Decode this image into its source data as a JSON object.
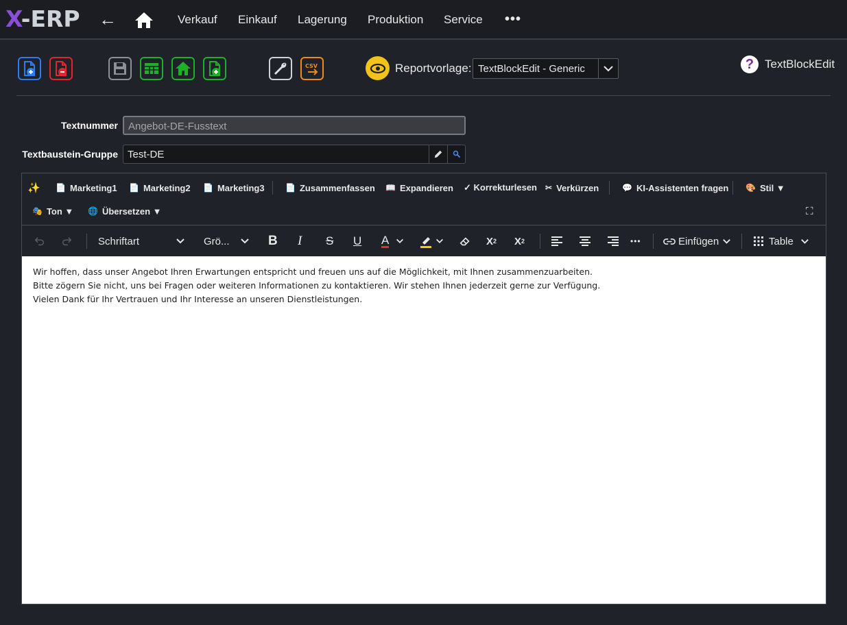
{
  "app": {
    "logo_x": "X",
    "logo_rest": "-ERP"
  },
  "nav": {
    "back_symbol": "←",
    "items": [
      {
        "label": "Verkauf"
      },
      {
        "label": "Einkauf"
      },
      {
        "label": "Lagerung"
      },
      {
        "label": "Produktion"
      },
      {
        "label": "Service"
      }
    ],
    "more_symbol": "•••"
  },
  "toolbar": {
    "csv_text": "CSV",
    "report_label": "Reportvorlage:",
    "report_selected": "TextBlockEdit - Generic",
    "help_symbol": "?",
    "page_name": "TextBlockEdit"
  },
  "form": {
    "textnummer_label": "Textnummer",
    "textnummer_value": "Angebot-DE-Fusstext",
    "gruppe_label": "Textbaustein-Gruppe",
    "gruppe_value": "Test-DE"
  },
  "ai_toolbar": {
    "sparkle": "✨",
    "marketing1": "Marketing1",
    "marketing2": "Marketing2",
    "marketing3": "Marketing3",
    "zusammenfassen": "Zusammenfassen",
    "expandieren": "Expandieren",
    "korrekturlesen": "✓ Korrekturlesen",
    "verkuerzen": "Verkürzen",
    "ki_fragen": "KI-Assistenten fragen",
    "stil": "Stil ▼",
    "ton": "Ton ▼",
    "uebersetzen": "Übersetzen ▼",
    "fullscreen": "⛶"
  },
  "format_toolbar": {
    "font_family": "Schriftart",
    "font_size": "Grö...",
    "bold": "B",
    "italic": "I",
    "strike": "S",
    "underline": "U",
    "font_color": "A",
    "subscript_base": "X",
    "subscript_mark": "2",
    "superscript_base": "X",
    "superscript_mark": "2",
    "more": "•••",
    "insert": "Einfügen",
    "table": "Table",
    "font_color_accent": "#e03030",
    "highlight_accent": "#f5d000"
  },
  "content": {
    "lines": [
      "Wir hoffen, dass unser Angebot Ihren Erwartungen entspricht und freuen uns auf die Möglichkeit, mit Ihnen zusammenzuarbeiten.",
      "Bitte zögern Sie nicht, uns bei Fragen oder weiteren Informationen zu kontaktieren. Wir stehen Ihnen jederzeit gerne zur Verfügung.",
      "Vielen Dank für Ihr Vertrauen und Ihr Interesse an unseren Dienstleistungen."
    ]
  },
  "colors": {
    "bg": "#1f2228",
    "blue": "#2f7cf0",
    "red": "#e0262e",
    "grey": "#8d9097",
    "green": "#1fb02a",
    "orange": "#f08a1a",
    "yellow": "#f2c318"
  }
}
